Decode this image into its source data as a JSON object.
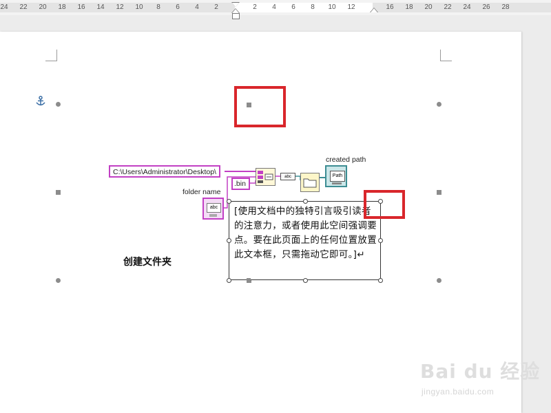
{
  "ruler": {
    "labels_left": [
      "24",
      "22",
      "20",
      "18",
      "16",
      "14",
      "12",
      "10",
      "8",
      "6",
      "4",
      "2"
    ],
    "labels_right": [
      "2",
      "4",
      "6",
      "8",
      "10",
      "12",
      "16",
      "18",
      "20",
      "22",
      "24",
      "26",
      "28"
    ]
  },
  "diagram": {
    "path_constant": "C:\\Users\\Administrator\\Desktop\\",
    "extension_constant": ".bin",
    "folder_name_label": "folder name",
    "folder_name_control": "abc",
    "created_path_label": "created path",
    "created_path_indicator": "Path",
    "to_string_node": "abc"
  },
  "textbox": {
    "text": "[使用文档中的独特引言吸引读者的注意力，或者使用此空间强调要点。要在此页面上的任何位置放置此文本框，只需拖动它即可。]↵"
  },
  "page_title": "创建文件夹",
  "watermark": {
    "brand": "Bai du 经验",
    "url": "jingyan.baidu.com"
  },
  "colors": {
    "highlight_red": "#d9262b",
    "labview_string_pink": "#c23fc4",
    "labview_path_teal": "#3c8d93"
  },
  "icons": {
    "anchor": "anchor-icon"
  }
}
